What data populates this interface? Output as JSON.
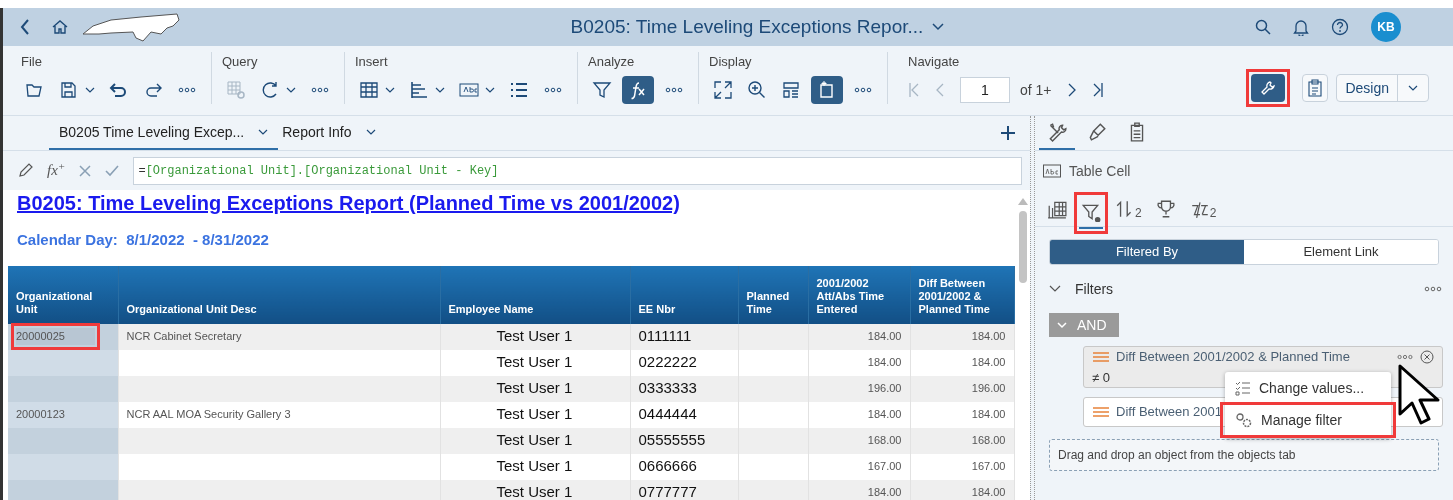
{
  "shell": {
    "title": "B0205: Time Leveling Exceptions Repor...",
    "avatar": "KB"
  },
  "toolbar": {
    "groups": [
      {
        "label": "File",
        "buttons": [
          {
            "kind": "open"
          },
          {
            "kind": "save",
            "caret": true
          },
          {
            "kind": "undo"
          },
          {
            "kind": "redo"
          },
          {
            "kind": "more"
          }
        ]
      },
      {
        "label": "Query",
        "buttons": [
          {
            "kind": "query",
            "disabled": true
          },
          {
            "kind": "refresh",
            "caret": true
          },
          {
            "kind": "more"
          }
        ]
      },
      {
        "label": "Insert",
        "buttons": [
          {
            "kind": "table",
            "caret": true
          },
          {
            "kind": "chart",
            "caret": true
          },
          {
            "kind": "textbox",
            "caret": true
          },
          {
            "kind": "list"
          },
          {
            "kind": "more"
          }
        ]
      },
      {
        "label": "Analyze",
        "buttons": [
          {
            "kind": "filter"
          },
          {
            "kind": "fx",
            "pressed": true
          },
          {
            "kind": "more"
          }
        ]
      },
      {
        "label": "Display",
        "buttons": [
          {
            "kind": "fullscreen"
          },
          {
            "kind": "zoom"
          },
          {
            "kind": "layout"
          },
          {
            "kind": "page",
            "pressed": true
          },
          {
            "kind": "more"
          }
        ]
      }
    ],
    "navigate": {
      "label": "Navigate",
      "page": "1",
      "of": "of 1+"
    },
    "wrench": {
      "pressed": true,
      "highlighted": true
    },
    "mode": "Design"
  },
  "report_tabs": [
    {
      "label": "B0205 Time Leveling Excep...",
      "selected": true
    },
    {
      "label": "Report Info",
      "selected": false
    }
  ],
  "formula_icon": "fx$^{+}$",
  "formula": "=[Organizational Unit].[Organizational Unit - Key]",
  "report": {
    "title": "B0205: Time Leveling Exceptions Report (Planned Time vs 2001/2002)",
    "subtitle": "Calendar Day:  8/1/2022  - 8/31/2022",
    "columns": [
      "Organizational Unit",
      "Organizational Unit Desc",
      "Employee Name",
      "EE Nbr",
      "Planned Time",
      "2001/2002 Att/Abs Time Entered",
      "Diff Between 2001/2002 & Planned Time"
    ],
    "rows": [
      {
        "org_unit": "20000025",
        "org_unit_desc": "NCR Cabinet Secretary",
        "employee_name": "Test User 1",
        "ee_nbr": "0111111",
        "att_abs": "184.00",
        "diff": "184.00",
        "highlighted": true
      },
      {
        "employee_name": "Test User 1",
        "ee_nbr": "0222222",
        "att_abs": "184.00",
        "diff": "184.00"
      },
      {
        "employee_name": "Test User 1",
        "ee_nbr": "0333333",
        "att_abs": "196.00",
        "diff": "196.00"
      },
      {
        "org_unit": "20000123",
        "org_unit_desc": "NCR AAL MOA Security Gallery 3",
        "employee_name": "Test User 1",
        "ee_nbr": "0444444",
        "att_abs": "184.00",
        "diff": "184.00"
      },
      {
        "employee_name": "Test User 1",
        "ee_nbr": "05555555",
        "att_abs": "168.00",
        "diff": "168.00"
      },
      {
        "employee_name": "Test User 1",
        "ee_nbr": "0666666",
        "att_abs": "167.00",
        "diff": "167.00"
      },
      {
        "employee_name": "Test User 1",
        "ee_nbr": "0777777",
        "att_abs": "184.00",
        "diff": "184.00"
      }
    ]
  },
  "side_panel": {
    "tabs": [
      {
        "kind": "tools",
        "selected": true
      },
      {
        "kind": "format",
        "selected": false
      },
      {
        "kind": "properties",
        "selected": false
      }
    ],
    "element": "Table Cell",
    "sub_tabs": [
      {
        "kind": "columns",
        "selected": false
      },
      {
        "kind": "filter",
        "selected": true,
        "highlighted": true
      },
      {
        "kind": "sort",
        "badge": "2",
        "selected": false
      },
      {
        "kind": "ranking",
        "selected": false
      },
      {
        "kind": "breaks",
        "badge": "2",
        "selected": false
      }
    ],
    "segments": [
      {
        "label": "Filtered By",
        "selected": true
      },
      {
        "label": "Element Link",
        "selected": false
      }
    ],
    "section": "Filters",
    "operator": "AND",
    "filters": [
      {
        "name": "Diff Between 2001/2002 & Planned Time",
        "value": "≠ 0"
      },
      {
        "name": "Diff Between 2001"
      }
    ],
    "menu": [
      {
        "label": "Change values...",
        "kind": "values",
        "highlighted": false
      },
      {
        "label": "Manage filter",
        "kind": "manage",
        "highlighted": true
      }
    ],
    "drop_hint": "Drag and drop an object from the objects tab"
  }
}
